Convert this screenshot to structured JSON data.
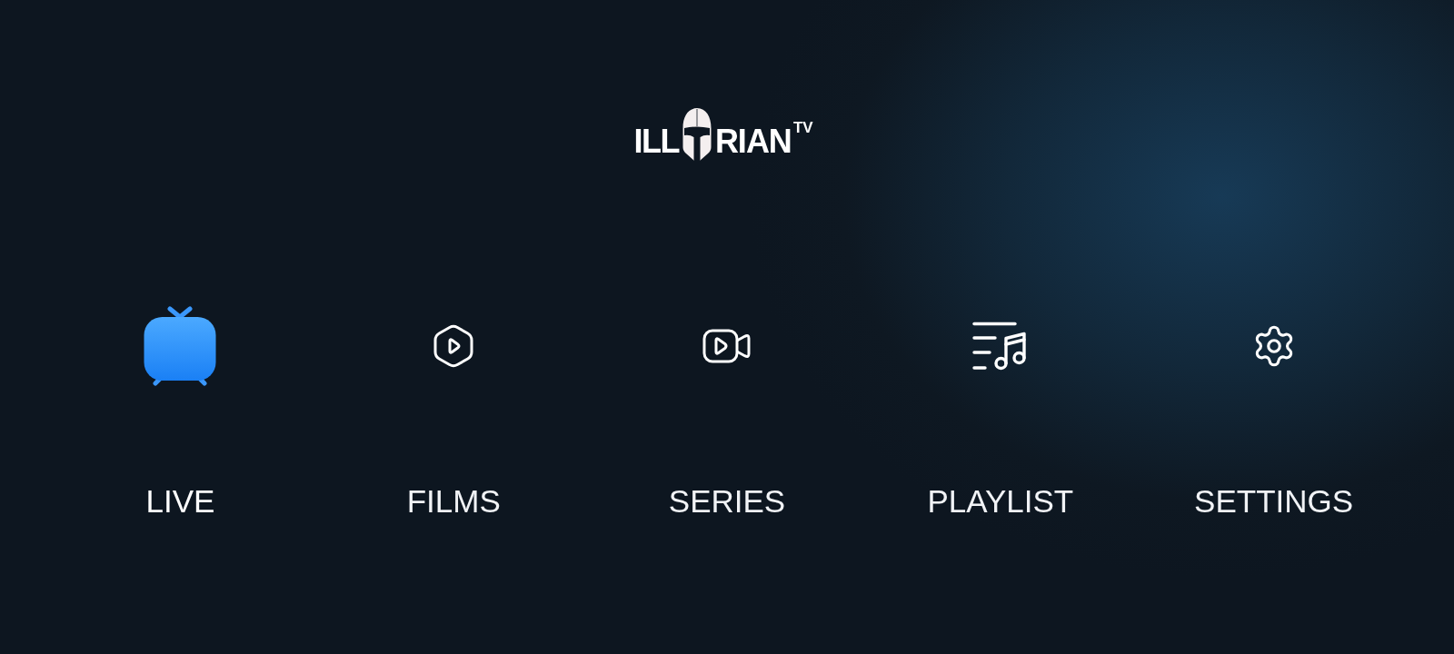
{
  "logo": {
    "text_before_icon": "ILL",
    "text_after_icon": "RIAN",
    "superscript": "TV"
  },
  "menu": [
    {
      "label": "LIVE",
      "kind": "live",
      "selected": true
    },
    {
      "label": "FILMS",
      "kind": "films",
      "selected": false
    },
    {
      "label": "SERIES",
      "kind": "series",
      "selected": false
    },
    {
      "label": "PLAYLIST",
      "kind": "playlist",
      "selected": false
    },
    {
      "label": "SETTINGS",
      "kind": "settings",
      "selected": false
    }
  ]
}
